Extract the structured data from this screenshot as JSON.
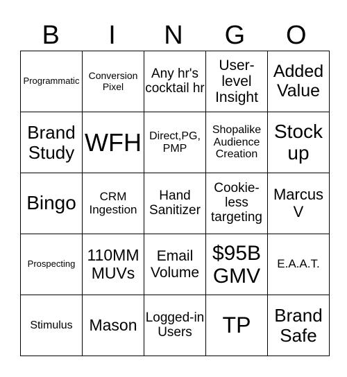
{
  "header": {
    "letters": [
      "B",
      "I",
      "N",
      "G",
      "O"
    ]
  },
  "grid": {
    "rows": [
      [
        "Programmatic",
        "Conversion Pixel",
        "Any hr's cocktail hr",
        "User-level Insight",
        "Added Value"
      ],
      [
        "Brand Study",
        "WFH",
        "Direct,PG, PMP",
        "Shopalike Audience Creation",
        "Stock up"
      ],
      [
        "Bingo",
        "CRM Ingestion",
        "Hand Sanitizer",
        "Cookie-less targeting",
        "Marcus V"
      ],
      [
        "Prospecting",
        "110MM MUVs",
        "Email Volume",
        "$95B GMV",
        "E.A.A.T."
      ],
      [
        "Stimulus",
        "Mason",
        "Logged-in Users",
        "TP",
        "Brand Safe"
      ]
    ]
  }
}
